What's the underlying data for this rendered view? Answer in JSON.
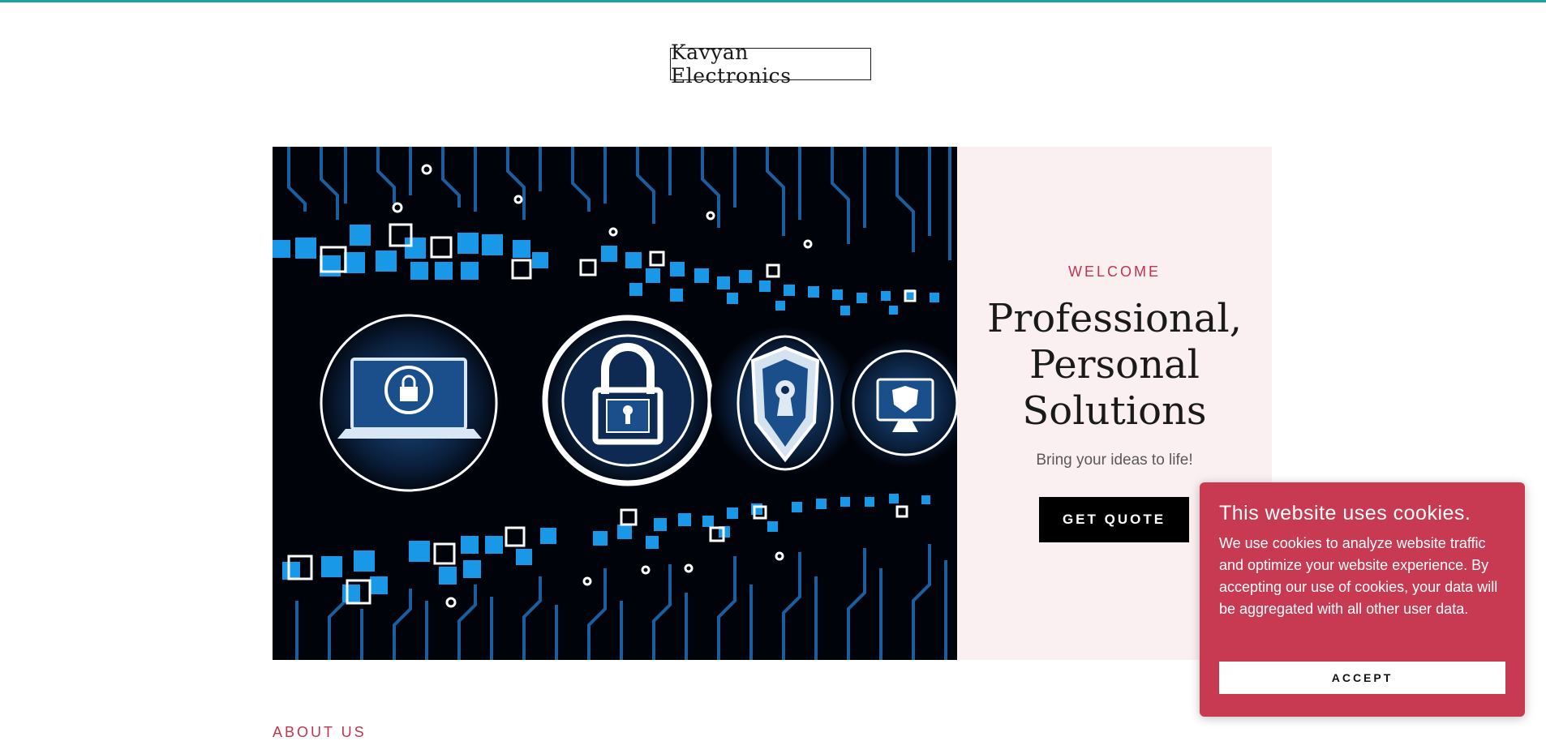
{
  "header": {
    "site_title": "Kavyan Electronics"
  },
  "hero": {
    "image_icon": "cyber-security-circuit-image",
    "welcome": "WELCOME",
    "headline_lines": [
      "Professional,",
      "Personal",
      "Solutions"
    ],
    "subline": "Bring your ideas to life!",
    "cta_label": "GET QUOTE"
  },
  "about": {
    "label": "ABOUT US"
  },
  "cookie_banner": {
    "title": "This website uses cookies.",
    "text": "We use cookies to analyze website traffic and optimize your website experience. By accepting our use of cookies, your data will be aggregated with all other user data.",
    "accept_label": "ACCEPT"
  },
  "colors": {
    "accent_teal": "#1aa5a0",
    "accent_red": "#c2334d",
    "cookie_bg": "#c73a51",
    "panel_bg": "#fbf0f1"
  }
}
